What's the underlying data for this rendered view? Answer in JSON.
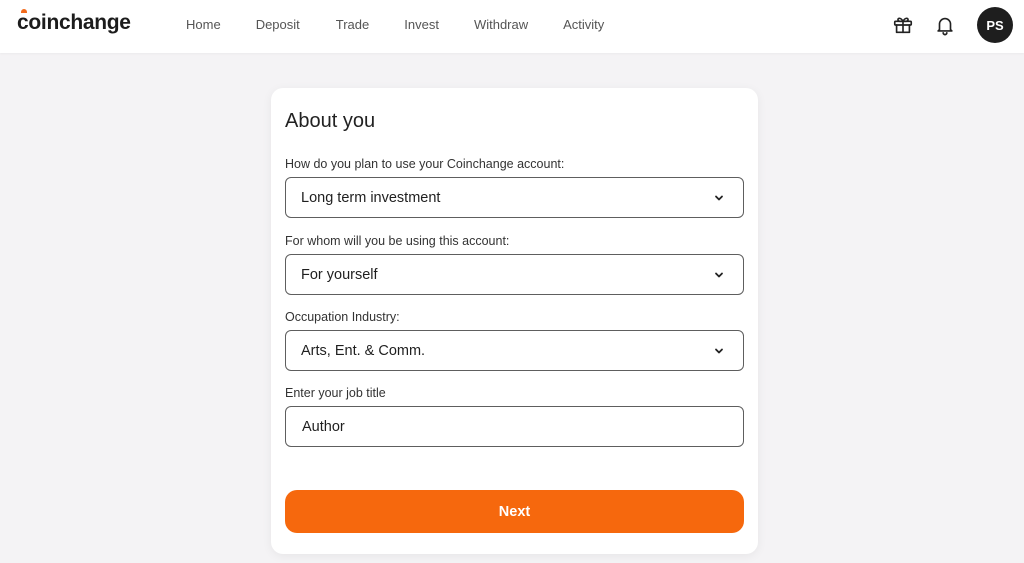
{
  "brand": {
    "name": "coinchange",
    "accent_color": "#f26a1b"
  },
  "nav": {
    "items": [
      {
        "label": "Home"
      },
      {
        "label": "Deposit"
      },
      {
        "label": "Trade"
      },
      {
        "label": "Invest"
      },
      {
        "label": "Withdraw"
      },
      {
        "label": "Activity"
      }
    ]
  },
  "header_icons": {
    "gift": "gift-icon",
    "notifications": "bell-icon"
  },
  "user": {
    "initials": "PS"
  },
  "form": {
    "title": "About you",
    "usage": {
      "label": "How do you plan to use your Coinchange account:",
      "value": "Long term investment"
    },
    "for_whom": {
      "label": "For whom will you be using this account:",
      "value": "For yourself"
    },
    "industry": {
      "label": "Occupation Industry:",
      "value": "Arts, Ent. & Comm."
    },
    "job_title": {
      "label": "Enter your job title",
      "value": "Author"
    },
    "submit_label": "Next",
    "button_color": "#f6680d"
  }
}
